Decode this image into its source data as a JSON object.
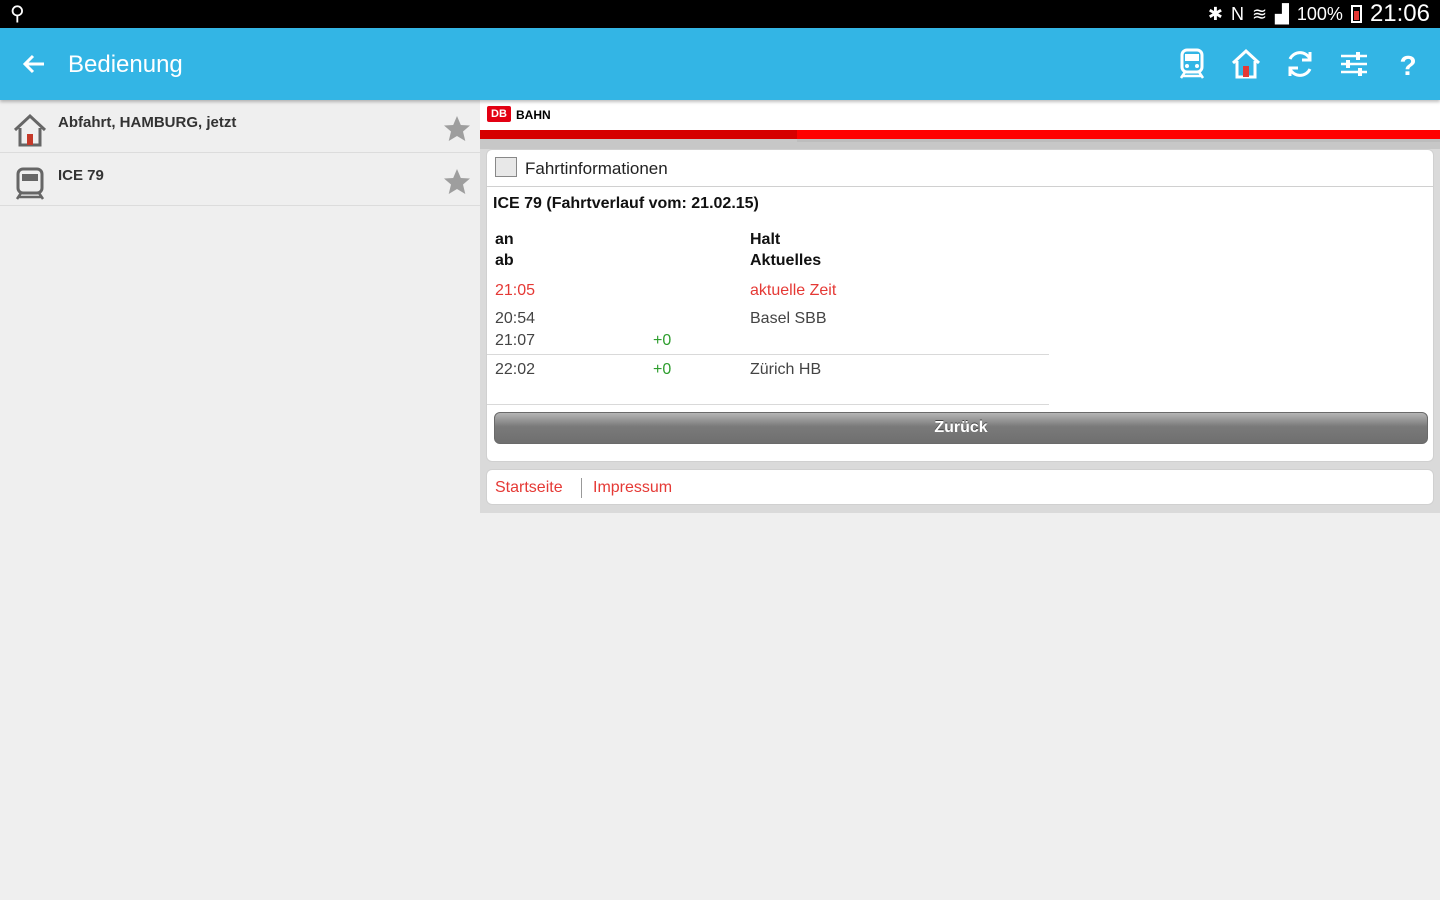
{
  "status_bar": {
    "battery": "100%",
    "time": "21:06"
  },
  "action_bar": {
    "title": "Bedienung"
  },
  "favorites": [
    {
      "label": "Abfahrt, HAMBURG, jetzt",
      "icon": "house-icon"
    },
    {
      "label": "ICE 79",
      "icon": "train-icon"
    }
  ],
  "web": {
    "brand": "BAHN",
    "logo": "DB",
    "panel_title": "Fahrtinformationen",
    "journey_title": "ICE 79 (Fahrtverlauf vom: 21.02.15)",
    "headers": {
      "an": "an",
      "ab": "ab",
      "halt": "Halt",
      "aktuelles": "Aktuelles"
    },
    "current": {
      "time": "21:05",
      "label": "aktuelle Zeit"
    },
    "stops": [
      {
        "arr": "20:54",
        "dep": "21:07",
        "delay": "+0",
        "station": "Basel SBB"
      },
      {
        "arr": "22:02",
        "delay": "+0",
        "station": "Zürich HB"
      }
    ],
    "back_button": "Zurück",
    "footer_links": [
      "Startseite",
      "Impressum"
    ]
  },
  "colors": {
    "accent": "#33b5e5",
    "db_red": "#ff0000",
    "delay_green": "#2e9e2e"
  }
}
